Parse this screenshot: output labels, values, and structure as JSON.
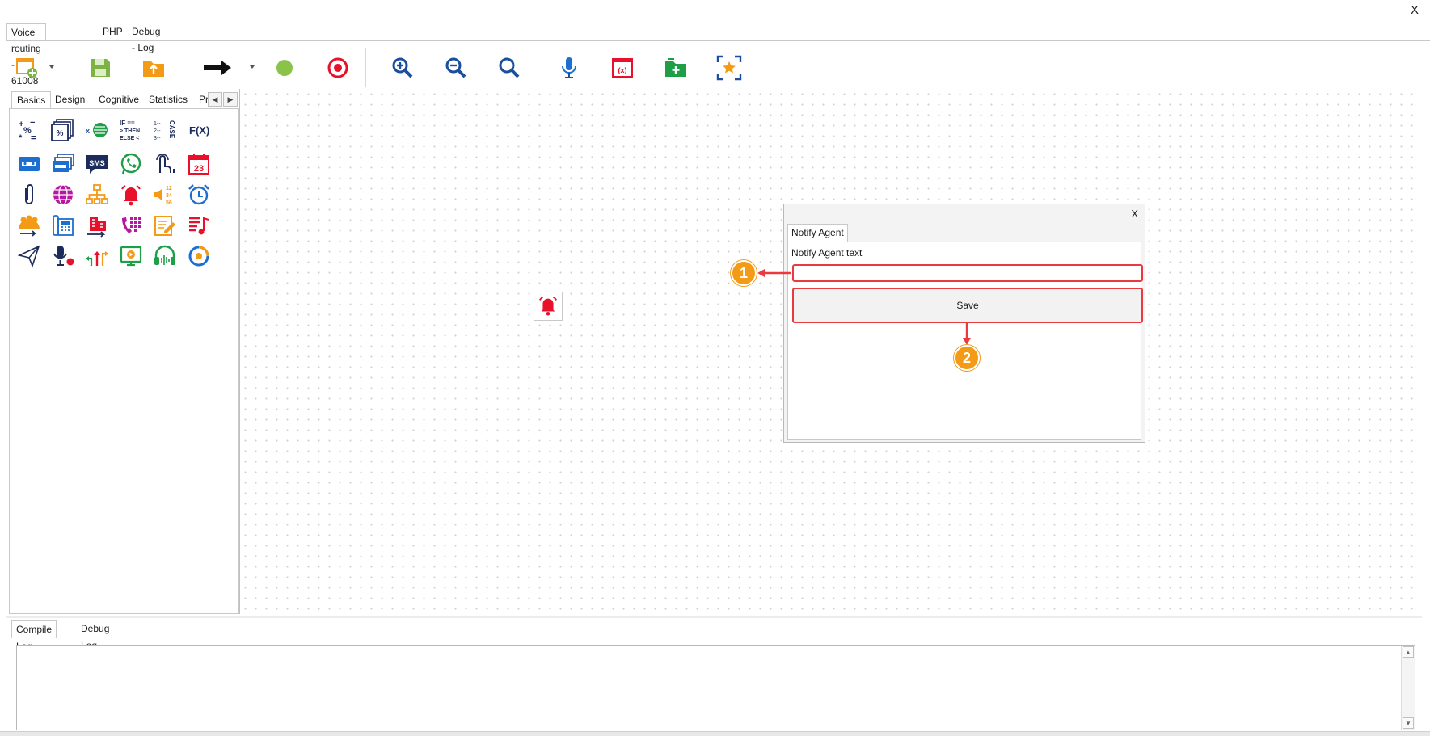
{
  "window": {
    "close_label": "X"
  },
  "top_tabs": [
    {
      "label": "Voice routing - 61008",
      "active": true
    },
    {
      "label": "PHP",
      "active": false
    },
    {
      "label": "Debug - Log",
      "active": false
    }
  ],
  "toolbar": {
    "icons": [
      "new-file-icon",
      "save-icon",
      "upload-icon",
      "arrow-right-icon",
      "green-dot-icon",
      "target-icon",
      "zoom-in-icon",
      "zoom-out-icon",
      "search-icon",
      "microphone-icon",
      "variable-icon",
      "add-folder-icon",
      "fit-screen-icon"
    ]
  },
  "left_panel": {
    "tabs": [
      "Basics",
      "Design",
      "Cognitive",
      "Statistics",
      "Pr"
    ],
    "active_tab": "Basics",
    "icons": [
      "math-operators-icon",
      "percent-table-icon",
      "global-variable-icon",
      "if-then-else-icon",
      "case-icon",
      "function-icon",
      "voicemail-card-icon",
      "multi-voicemail-icon",
      "sms-icon",
      "whatsapp-icon",
      "touch-tone-icon",
      "calendar-icon",
      "attachment-icon",
      "globe-icon",
      "hierarchy-icon",
      "alarm-bell-icon",
      "number-reader-icon",
      "alarm-clock-icon",
      "team-forward-icon",
      "phone-book-icon",
      "building-forward-icon",
      "dial-pad-icon",
      "note-edit-icon",
      "playlist-icon",
      "send-icon",
      "record-mic-icon",
      "split-arrows-icon",
      "screen-play-icon",
      "headset-icon",
      "rotate-icon"
    ],
    "pal_labels": {
      "sms": "SMS",
      "fx": "F(X)",
      "cal": "23",
      "if_then": "IF ==",
      "then": "> THEN",
      "else": "ELSE <",
      "case": "CASE",
      "nums": "12 34 56"
    }
  },
  "canvas": {
    "node_icon": "bell-icon"
  },
  "dialog": {
    "close_label": "X",
    "tab_label": "Notify Agent",
    "field_label": "Notify Agent text",
    "field_value": "",
    "save_label": "Save"
  },
  "annotations": {
    "callout_1": "1",
    "callout_2": "2"
  },
  "bottom": {
    "tabs": [
      "Compile Log",
      "Debug Log"
    ],
    "active_tab": "Compile Log",
    "log_text": ""
  },
  "colors": {
    "accent_red": "#e93a3f",
    "callout_orange": "#f39a16",
    "bell_red": "#e8102a",
    "brand_blue": "#1c4e9c"
  }
}
